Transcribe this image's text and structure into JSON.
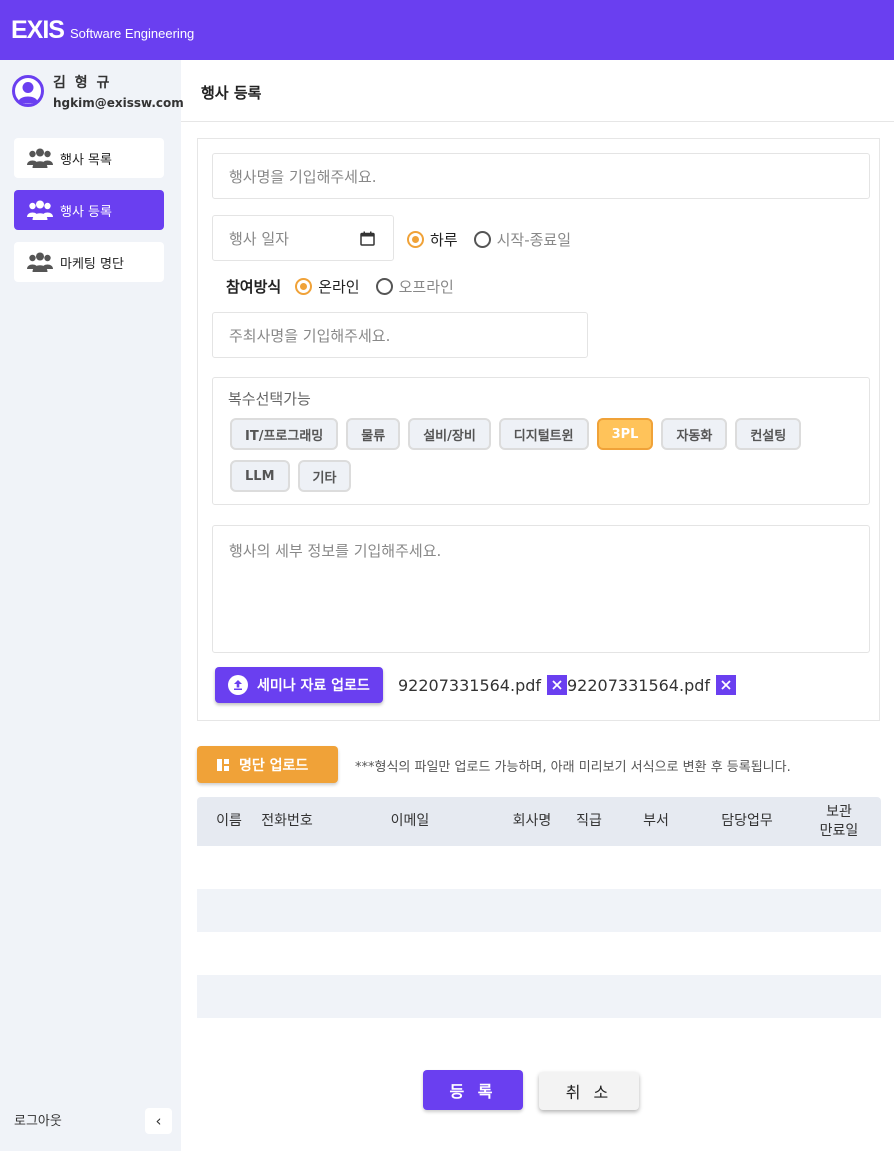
{
  "brand": {
    "mark": "EXIS",
    "text": "Software Engineering",
    "color": "#6a3ff0",
    "accent": "#f0a238"
  },
  "user": {
    "name": "김 형 규",
    "email": "hgkim@exissw.com"
  },
  "sidebar": {
    "items": [
      {
        "label": "행사 목록",
        "icon": "users-icon",
        "active": false
      },
      {
        "label": "행사 등록",
        "icon": "users-icon",
        "active": true
      },
      {
        "label": "마케팅 명단",
        "icon": "users-icon",
        "active": false
      }
    ],
    "logout_label": "로그아웃",
    "collapse_icon": "chevron-left-icon"
  },
  "page": {
    "title": "행사 등록"
  },
  "form": {
    "event_name_placeholder": "행사명을 기입해주세요.",
    "event_date_placeholder": "행사 일자",
    "date_options": [
      {
        "label": "하루",
        "selected": true
      },
      {
        "label": "시작-종료일",
        "selected": false
      }
    ],
    "mode_label": "참여방식",
    "mode_options": [
      {
        "label": "온라인",
        "selected": true
      },
      {
        "label": "오프라인",
        "selected": false
      }
    ],
    "host_placeholder": "주최사명을 기입해주세요.",
    "category_title": "복수선택가능",
    "categories": [
      {
        "label": "IT/프로그래밍",
        "selected": false
      },
      {
        "label": "물류",
        "selected": false
      },
      {
        "label": "설비/장비",
        "selected": false
      },
      {
        "label": "디지털트윈",
        "selected": false
      },
      {
        "label": "3PL",
        "selected": true
      },
      {
        "label": "자동화",
        "selected": false
      },
      {
        "label": "컨설팅",
        "selected": false
      },
      {
        "label": "LLM",
        "selected": false
      },
      {
        "label": "기타",
        "selected": false
      }
    ],
    "detail_placeholder": "행사의 세부 정보를 기입해주세요.",
    "upload_label": "세미나 자료 업로드",
    "files": [
      "92207331564.pdf",
      "92207331564.pdf"
    ]
  },
  "list_upload": {
    "label": "명단 업로드",
    "notice": "***형식의 파일만 업로드 가능하며, 아래 미리보기 서식으로 변환 후 등록됩니다."
  },
  "table": {
    "headers": [
      "이름",
      "전화번호",
      "이메일",
      "회사명",
      "직급",
      "부서",
      "담당업무",
      "보관\n만료일"
    ],
    "rows": []
  },
  "actions": {
    "submit": "등 록",
    "cancel": "취 소"
  }
}
